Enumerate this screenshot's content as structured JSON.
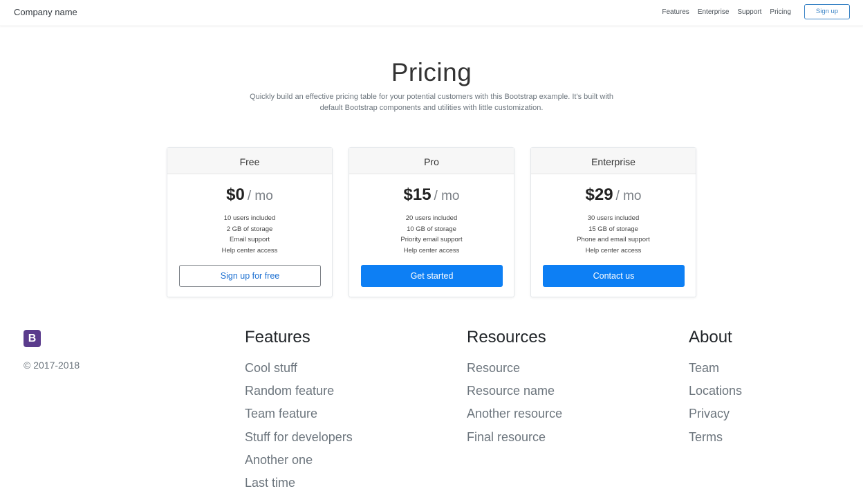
{
  "navbar": {
    "brand": "Company name",
    "links": [
      "Features",
      "Enterprise",
      "Support",
      "Pricing"
    ],
    "signup_label": "Sign up"
  },
  "hero": {
    "title": "Pricing",
    "lead": "Quickly build an effective pricing table for your potential customers with this Bootstrap example. It's built with default Bootstrap components and utilities with little customization."
  },
  "plans": [
    {
      "name": "Free",
      "price": "$0",
      "unit": "/ mo",
      "features": [
        "10 users included",
        "2 GB of storage",
        "Email support",
        "Help center access"
      ],
      "button": "Sign up for free",
      "button_style": "outline"
    },
    {
      "name": "Pro",
      "price": "$15",
      "unit": "/ mo",
      "features": [
        "20 users included",
        "10 GB of storage",
        "Priority email support",
        "Help center access"
      ],
      "button": "Get started",
      "button_style": "primary"
    },
    {
      "name": "Enterprise",
      "price": "$29",
      "unit": "/ mo",
      "features": [
        "30 users included",
        "15 GB of storage",
        "Phone and email support",
        "Help center access"
      ],
      "button": "Contact us",
      "button_style": "primary"
    }
  ],
  "footer": {
    "logo_letter": "B",
    "logo_color": "#5a3b8c",
    "copyright": "© 2017-2018",
    "columns": [
      {
        "title": "Features",
        "links": [
          "Cool stuff",
          "Random feature",
          "Team feature",
          "Stuff for developers",
          "Another one",
          "Last time"
        ]
      },
      {
        "title": "Resources",
        "links": [
          "Resource",
          "Resource name",
          "Another resource",
          "Final resource"
        ]
      },
      {
        "title": "About",
        "links": [
          "Team",
          "Locations",
          "Privacy",
          "Terms"
        ]
      }
    ]
  },
  "colors": {
    "primary": "#0d7ff4",
    "outline_border": "#7a7f85",
    "muted_text": "#6c757d"
  }
}
